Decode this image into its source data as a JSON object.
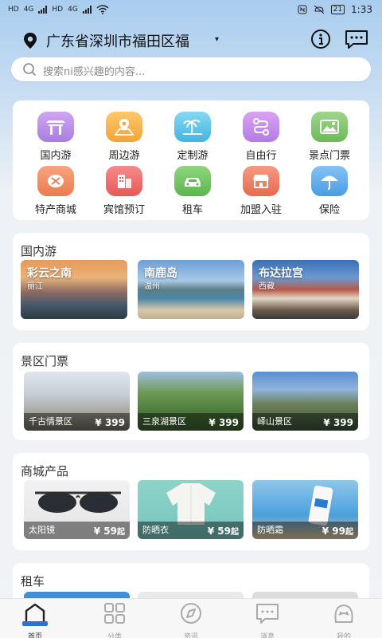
{
  "statusbar": {
    "left_hd1": "HD",
    "left_net1": "4G",
    "left_hd2": "HD",
    "left_net2": "4G",
    "battery": "21",
    "time": "1:33"
  },
  "header": {
    "location": "广东省深圳市福田区福"
  },
  "search": {
    "placeholder": "搜索ni感兴趣的内容..."
  },
  "categories": [
    {
      "label": "国内游",
      "icon": "temple-icon",
      "color": "#b98be4"
    },
    {
      "label": "周边游",
      "icon": "map-pin-icon",
      "color": "#f7b24c"
    },
    {
      "label": "定制游",
      "icon": "palm-beach-icon",
      "color": "#62c4e8"
    },
    {
      "label": "自由行",
      "icon": "route-icon",
      "color": "#c78ae6"
    },
    {
      "label": "景点门票",
      "icon": "picture-ticket-icon",
      "color": "#7cc36a"
    },
    {
      "label": "特产商城",
      "icon": "gift-icon",
      "color": "#f08a5e"
    },
    {
      "label": "宾馆预订",
      "icon": "hotel-icon",
      "color": "#ef6b6b"
    },
    {
      "label": "租车",
      "icon": "car-icon",
      "color": "#66c05c"
    },
    {
      "label": "加盟入驻",
      "icon": "store-icon",
      "color": "#ee7a5e"
    },
    {
      "label": "保险",
      "icon": "umbrella-icon",
      "color": "#5aa9ea"
    }
  ],
  "domestic": {
    "title": "国内游",
    "items": [
      {
        "name": "彩云之南",
        "sub": "丽江"
      },
      {
        "name": "南鹿岛",
        "sub": "温州"
      },
      {
        "name": "布达拉宫",
        "sub": "西藏"
      }
    ]
  },
  "tickets": {
    "title": "景区门票",
    "items": [
      {
        "name": "千古情景区",
        "price": "¥ 399"
      },
      {
        "name": "三泉湖景区",
        "price": "¥ 399"
      },
      {
        "name": "峄山景区",
        "price": "¥ 399"
      }
    ]
  },
  "mall": {
    "title": "商城产品",
    "items": [
      {
        "name": "太阳镜",
        "price": "¥ 59",
        "unit": "起"
      },
      {
        "name": "防晒衣",
        "price": "¥ 59",
        "unit": "起"
      },
      {
        "name": "防晒霜",
        "price": "¥ 99",
        "unit": "起"
      }
    ]
  },
  "rental": {
    "title": "租车"
  },
  "tabbar": [
    {
      "label": "首页",
      "icon": "home-icon",
      "active": true
    },
    {
      "label": "分类",
      "icon": "grid-icon",
      "active": false
    },
    {
      "label": "资讯",
      "icon": "compass-icon",
      "active": false
    },
    {
      "label": "消息",
      "icon": "chat-icon",
      "active": false
    },
    {
      "label": "我的",
      "icon": "user-icon",
      "active": false
    }
  ],
  "colors": {
    "accent": "#2e6fd8",
    "header_gradient_top": "#a9cdef"
  }
}
